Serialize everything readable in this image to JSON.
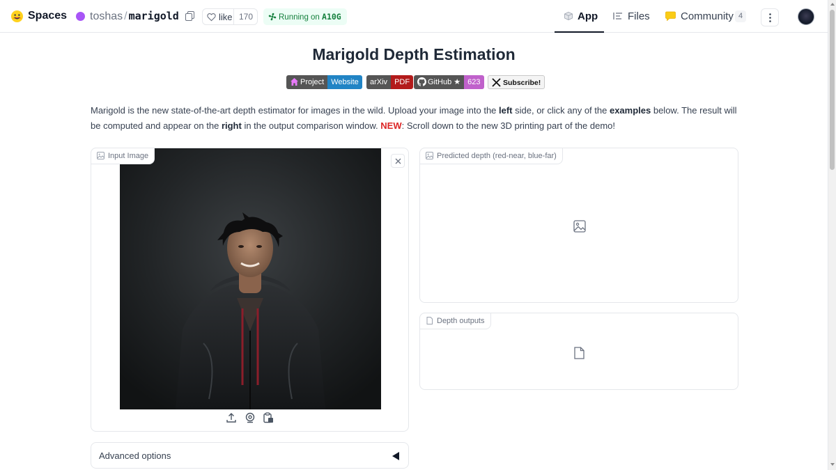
{
  "header": {
    "spaces_label": "Spaces",
    "owner": "toshas",
    "separator": "/",
    "repo_name": "marigold",
    "like_label": "like",
    "like_count": "170",
    "running_prefix": "Running on",
    "hardware": "A10G",
    "tabs": [
      {
        "label": "App",
        "active": true,
        "icon": "cube-icon"
      },
      {
        "label": "Files",
        "active": false,
        "icon": "files-icon"
      },
      {
        "label": "Community",
        "active": false,
        "icon": "community-icon",
        "count": "4"
      }
    ]
  },
  "main": {
    "title": "Marigold Depth Estimation",
    "badges": [
      {
        "left": "Project",
        "right": "Website",
        "icon": "home-icon",
        "color": "#2184c5"
      },
      {
        "left": "arXiv",
        "right": "PDF",
        "color": "#b31b1b"
      },
      {
        "left": "GitHub ★",
        "right": "623",
        "icon": "github-icon",
        "color": "#c061cb"
      },
      {
        "left": "Subscribe!",
        "icon": "x-logo-icon"
      }
    ],
    "intro": {
      "p1": "Marigold is the new state-of-the-art depth estimator for images in the wild. Upload your image into the ",
      "b1": "left",
      "p2": " side, or click any of the ",
      "b2": "examples",
      "p3": " below. The result will be computed and appear on the ",
      "b3": "right",
      "p4": " in the output comparison window. ",
      "new": "NEW",
      "p5": ": Scroll down to the new 3D printing part of the demo!"
    },
    "input_panel": {
      "label": "Input Image"
    },
    "depth_panel": {
      "label": "Predicted depth (red-near, blue-far)"
    },
    "outputs_panel": {
      "label": "Depth outputs"
    },
    "advanced": {
      "label": "Advanced options"
    }
  },
  "colors": {
    "accent_running": "#15803d",
    "new_highlight": "#dc2626",
    "owner_dot": "#a855f7"
  }
}
